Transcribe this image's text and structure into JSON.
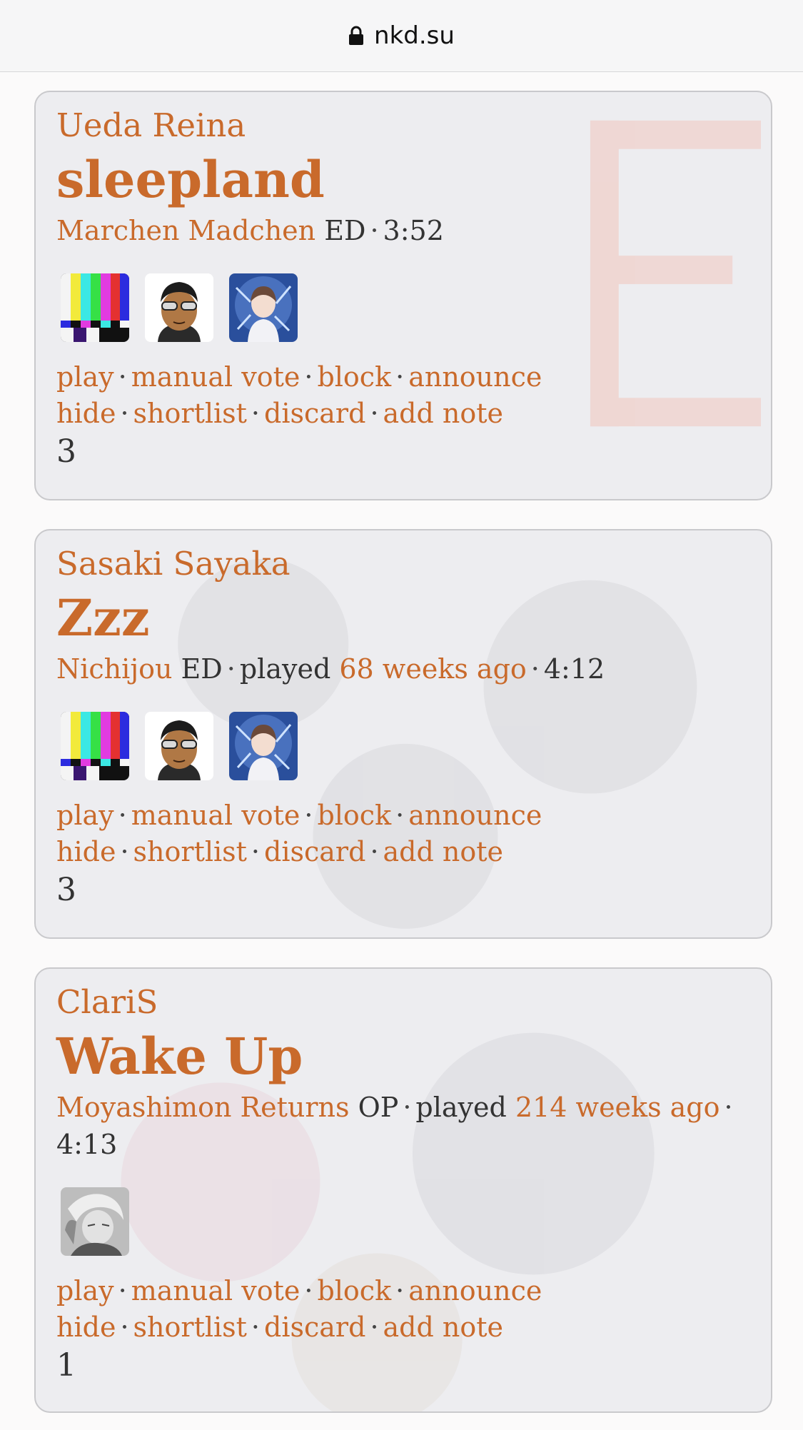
{
  "browser": {
    "url": "nkd.su"
  },
  "tracks": [
    {
      "artist": "Ueda Reina",
      "title": "sleepland",
      "anime": "Marchen Madchen",
      "role": "ED",
      "played_label": "",
      "played_ago": "",
      "length": "3:52",
      "avatars": [
        "test-card-avatar",
        "sunglasses-character-avatar",
        "blue-anime-avatar"
      ],
      "actions_row1": [
        "play",
        "manual vote",
        "block",
        "announce"
      ],
      "actions_row2": [
        "hide",
        "shortlist",
        "discard",
        "add note"
      ],
      "votes": "3"
    },
    {
      "artist": "Sasaki Sayaka",
      "title": "Zzz",
      "anime": "Nichijou",
      "role": "ED",
      "played_label": "played",
      "played_ago": "68 weeks ago",
      "length": "4:12",
      "avatars": [
        "test-card-avatar",
        "sunglasses-character-avatar",
        "blue-anime-avatar"
      ],
      "actions_row1": [
        "play",
        "manual vote",
        "block",
        "announce"
      ],
      "actions_row2": [
        "hide",
        "shortlist",
        "discard",
        "add note"
      ],
      "votes": "3"
    },
    {
      "artist": "ClariS",
      "title": "Wake Up",
      "anime": "Moyashimon Returns",
      "role": "OP",
      "played_label": "played",
      "played_ago": "214 weeks ago",
      "length": "4:13",
      "avatars": [
        "grey-anime-avatar"
      ],
      "actions_row1": [
        "play",
        "manual vote",
        "block",
        "announce"
      ],
      "actions_row2": [
        "hide",
        "shortlist",
        "discard",
        "add note"
      ],
      "votes": "1"
    }
  ],
  "colors": {
    "accent": "#c96a2b",
    "text": "#333333",
    "card_border": "#c9c9cc"
  }
}
